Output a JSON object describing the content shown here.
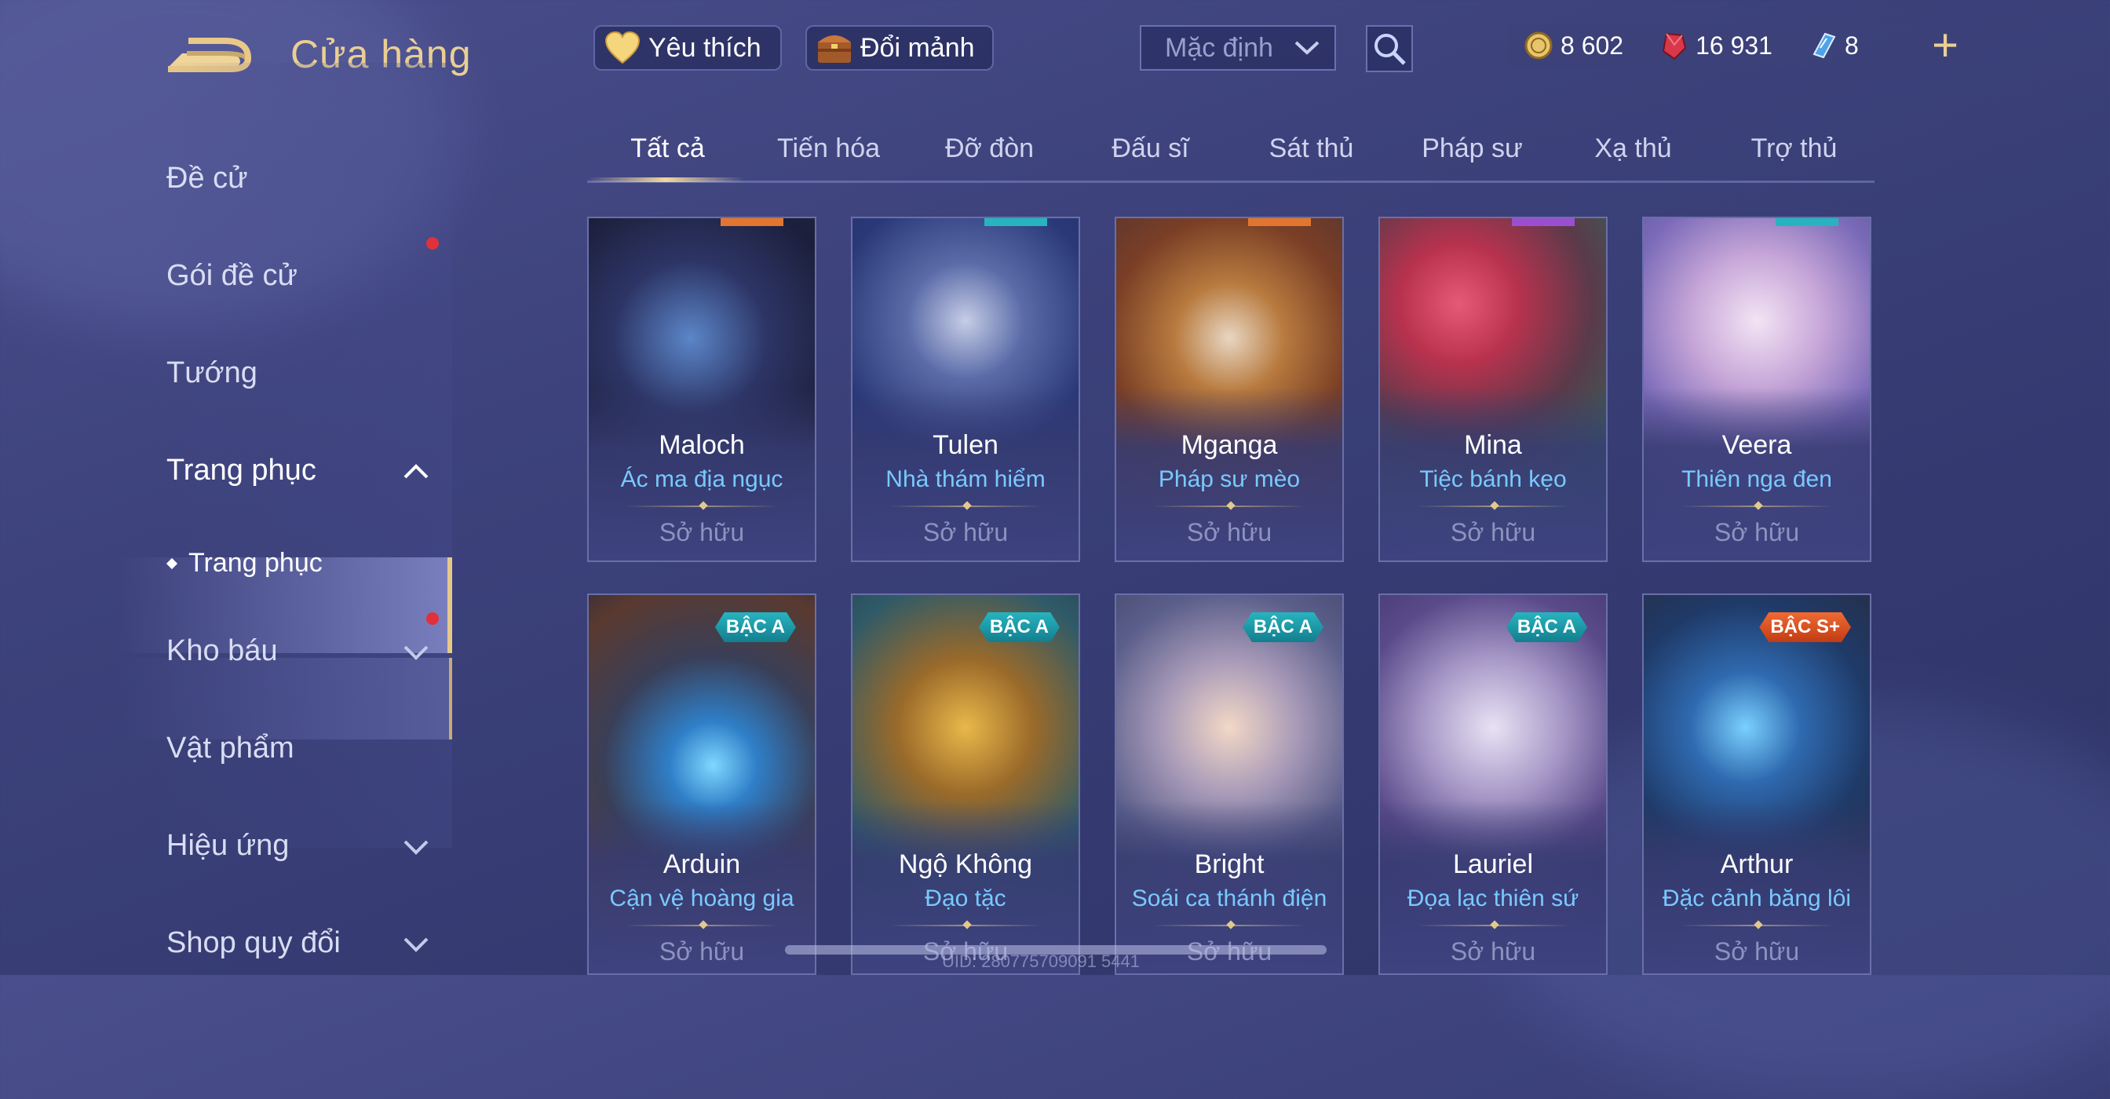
{
  "header": {
    "title": "Cửa hàng",
    "favorites_label": "Yêu thích",
    "exchange_label": "Đổi mảnh",
    "sort_select": {
      "selected": "Mặc định"
    },
    "currencies": [
      {
        "name": "gold",
        "icon": "gold-coin-icon",
        "value": "8 602"
      },
      {
        "name": "ruby",
        "icon": "ruby-gem-icon",
        "value": "16 931"
      },
      {
        "name": "voucher",
        "icon": "voucher-icon",
        "value": "8"
      }
    ],
    "plus_label": "+"
  },
  "sidebar": {
    "items": [
      {
        "label": "Đề cử"
      },
      {
        "label": "Gói đề cử"
      },
      {
        "label": "Tướng"
      },
      {
        "label": "Trang phục"
      },
      {
        "label": "Trang phục"
      },
      {
        "label": "Kho báu"
      },
      {
        "label": "Vật phẩm"
      },
      {
        "label": "Hiệu ứng"
      },
      {
        "label": "Shop quy đổi"
      }
    ]
  },
  "tabs": [
    {
      "label": "Tất cả"
    },
    {
      "label": "Tiến hóa"
    },
    {
      "label": "Đỡ đòn"
    },
    {
      "label": "Đấu sĩ"
    },
    {
      "label": "Sát thủ"
    },
    {
      "label": "Pháp sư"
    },
    {
      "label": "Xạ thủ"
    },
    {
      "label": "Trợ thủ"
    }
  ],
  "cards": [
    {
      "hero": "Maloch",
      "skin": "Ác ma địa ngục",
      "status": "Sở hữu"
    },
    {
      "hero": "Tulen",
      "skin": "Nhà thám hiểm",
      "status": "Sở hữu"
    },
    {
      "hero": "Mganga",
      "skin": "Pháp sư mèo",
      "status": "Sở hữu"
    },
    {
      "hero": "Mina",
      "skin": "Tiệc bánh kẹo",
      "status": "Sở hữu"
    },
    {
      "hero": "Veera",
      "skin": "Thiên nga đen",
      "status": "Sở hữu"
    },
    {
      "hero": "Arduin",
      "skin": "Cận vệ hoàng gia",
      "status": "Sở hữu",
      "tier": "BẬC A"
    },
    {
      "hero": "Ngộ Không",
      "skin": "Đạo tặc",
      "status": "Sở hữu",
      "tier": "BẬC A"
    },
    {
      "hero": "Bright",
      "skin": "Soái ca thánh điện",
      "status": "Sở hữu",
      "tier": "BẬC A"
    },
    {
      "hero": "Lauriel",
      "skin": "Đọa lạc thiên sứ",
      "status": "Sở hữu",
      "tier": "BẬC A"
    },
    {
      "hero": "Arthur",
      "skin": "Đặc cảnh băng lôi",
      "status": "Sở hữu",
      "tier": "BẬC S+"
    }
  ],
  "footer": {
    "uid": "UID: 280775709091 5441"
  },
  "colors": {
    "accent_gold": "#e9cf94",
    "skin_name": "#79c9ff",
    "tier_a": "#1f9fae",
    "tier_s_plus": "#e0542a",
    "badge_red": "#e0303a"
  }
}
